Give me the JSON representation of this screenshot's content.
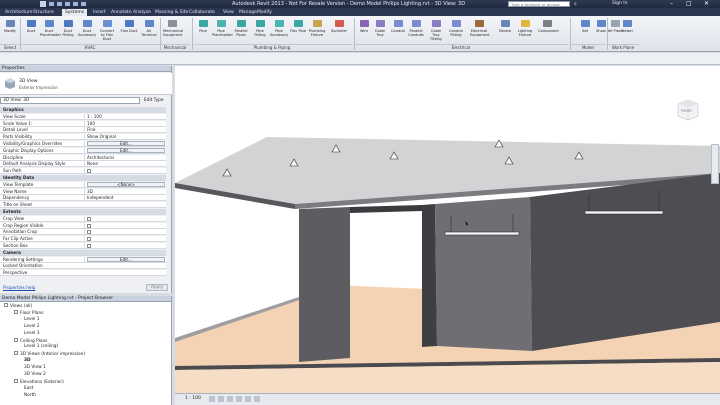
{
  "window": {
    "title": "Autodesk Revit 2013 - Not For Resale Version - Demo Model Philips Lighting.rvt - 3D View: 3D",
    "search_placeholder": "Type a keyword or phrase",
    "sign_in": "Sign In"
  },
  "tabs": [
    "Architecture",
    "Structure",
    "Systems",
    "Insert",
    "Annotate",
    "Analyze",
    "Massing & Site",
    "Collaborate",
    "View",
    "Manage",
    "Modify"
  ],
  "active_tab": "Systems",
  "ribbon": {
    "buttons": [
      {
        "id": "modify",
        "label": "Modify"
      },
      {
        "id": "duct",
        "label": "Duct"
      },
      {
        "id": "duct-placeholder",
        "label": "Duct Placeholder"
      },
      {
        "id": "duct-fitting",
        "label": "Duct Fitting"
      },
      {
        "id": "duct-accessory",
        "label": "Duct Accessory"
      },
      {
        "id": "convert-flex",
        "label": "Convert to Flex Duct"
      },
      {
        "id": "flex-duct",
        "label": "Flex Duct"
      },
      {
        "id": "air-terminal",
        "label": "Air Terminal"
      },
      {
        "id": "mechanical-equipment",
        "label": "Mechanical Equipment"
      },
      {
        "id": "pipe",
        "label": "Pipe"
      },
      {
        "id": "pipe-placeholder",
        "label": "Pipe Placeholder"
      },
      {
        "id": "parallel-pipes",
        "label": "Parallel Pipes"
      },
      {
        "id": "pipe-fitting",
        "label": "Pipe Fitting"
      },
      {
        "id": "pipe-accessory",
        "label": "Pipe Accessory"
      },
      {
        "id": "flex-pipe",
        "label": "Flex Pipe"
      },
      {
        "id": "plumbing-fixture",
        "label": "Plumbing Fixture"
      },
      {
        "id": "sprinkler",
        "label": "Sprinkler"
      },
      {
        "id": "wire",
        "label": "Wire"
      },
      {
        "id": "cable-tray",
        "label": "Cable Tray"
      },
      {
        "id": "conduit",
        "label": "Conduit"
      },
      {
        "id": "parallel-conduits",
        "label": "Parallel Conduits"
      },
      {
        "id": "cable-tray-fitting",
        "label": "Cable Tray Fitting"
      },
      {
        "id": "conduit-fitting",
        "label": "Conduit Fitting"
      },
      {
        "id": "electrical-equipment",
        "label": "Electrical Equipment"
      },
      {
        "id": "device",
        "label": "Device"
      },
      {
        "id": "lighting-fixture",
        "label": "Lighting Fixture"
      },
      {
        "id": "component",
        "label": "Component"
      },
      {
        "id": "set",
        "label": "Set"
      },
      {
        "id": "show",
        "label": "Show"
      },
      {
        "id": "ref-plane",
        "label": "Ref Plane"
      },
      {
        "id": "viewer",
        "label": "Viewer"
      }
    ],
    "groups": [
      "Select",
      "HVAC",
      "Mechanical",
      "Plumbing & Piping",
      "Electrical",
      "Model",
      "Work Plane"
    ]
  },
  "properties": {
    "title": "Properties",
    "type_name": "3D View",
    "type_sub": "Exterior Impression",
    "selector": "3D View: 3D",
    "edit_type": "Edit Type",
    "rows": [
      {
        "k": "Graphics",
        "v": "",
        "section": true
      },
      {
        "k": "View Scale",
        "v": "1 : 100"
      },
      {
        "k": "Scale Value  1:",
        "v": "100"
      },
      {
        "k": "Detail Level",
        "v": "Fine"
      },
      {
        "k": "Parts Visibility",
        "v": "Show Original"
      },
      {
        "k": "Visibility/Graphics Overrides",
        "v": "Edit...",
        "button": true
      },
      {
        "k": "Graphic Display Options",
        "v": "Edit...",
        "button": true
      },
      {
        "k": "Discipline",
        "v": "Architectural"
      },
      {
        "k": "Default Analysis Display Style",
        "v": "None"
      },
      {
        "k": "Sun Path",
        "v": "",
        "check": true
      },
      {
        "k": "Identity Data",
        "v": "",
        "section": true
      },
      {
        "k": "View Template",
        "v": "<None>",
        "button": true
      },
      {
        "k": "View Name",
        "v": "3D"
      },
      {
        "k": "Dependency",
        "v": "Independent"
      },
      {
        "k": "Title on Sheet",
        "v": ""
      },
      {
        "k": "Extents",
        "v": "",
        "section": true
      },
      {
        "k": "Crop View",
        "v": "",
        "check": true
      },
      {
        "k": "Crop Region Visible",
        "v": "",
        "check": true
      },
      {
        "k": "Annotation Crop",
        "v": "",
        "check": true
      },
      {
        "k": "Far Clip Active",
        "v": "",
        "check": true
      },
      {
        "k": "Section Box",
        "v": "",
        "check": true
      },
      {
        "k": "Camera",
        "v": "",
        "section": true
      },
      {
        "k": "Rendering Settings",
        "v": "Edit...",
        "button": true
      },
      {
        "k": "Locked Orientation",
        "v": ""
      },
      {
        "k": "Perspective",
        "v": ""
      }
    ],
    "help_link": "Properties help",
    "apply": "Apply"
  },
  "browser": {
    "title": "Demo Model Philips Lighting.rvt - Project Browser",
    "items": [
      {
        "label": "Views (all)",
        "indent": 0,
        "toggle": "-"
      },
      {
        "label": "Floor Plans",
        "indent": 1,
        "toggle": "-"
      },
      {
        "label": "Level 1",
        "indent": 2,
        "toggle": ""
      },
      {
        "label": "Level 2",
        "indent": 2,
        "toggle": ""
      },
      {
        "label": "Level 3",
        "indent": 2,
        "toggle": ""
      },
      {
        "label": "Ceiling Plans",
        "indent": 1,
        "toggle": "-"
      },
      {
        "label": "Level 1 (ceiling)",
        "indent": 2,
        "toggle": ""
      },
      {
        "label": "3D Views (Interior impression)",
        "indent": 1,
        "toggle": "-"
      },
      {
        "label": "3D",
        "indent": 2,
        "toggle": "",
        "bold": true
      },
      {
        "label": "3D View 1",
        "indent": 2,
        "toggle": ""
      },
      {
        "label": "3D View 2",
        "indent": 2,
        "toggle": ""
      },
      {
        "label": "Elevations (Exterior)",
        "indent": 1,
        "toggle": "-"
      },
      {
        "label": "East",
        "indent": 2,
        "toggle": ""
      },
      {
        "label": "North",
        "indent": 2,
        "toggle": ""
      }
    ]
  },
  "viewcube": {
    "label": "FRONT"
  },
  "status": {
    "scale": "1 : 100"
  },
  "colors": {
    "floor": "#f4d3b5",
    "wall_dark": "#4a4a4e",
    "wall_mid": "#6b6b70",
    "roof_top": "#d3d3d5",
    "ribbon_dark": "#2b3650"
  }
}
